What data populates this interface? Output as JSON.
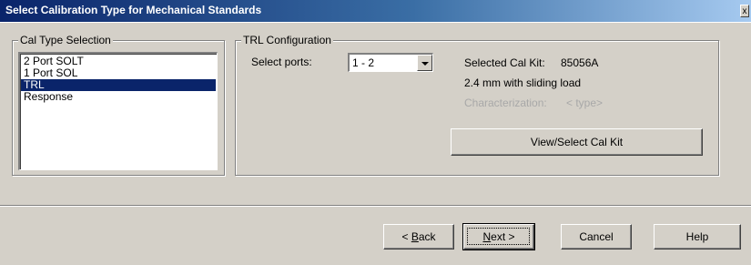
{
  "window": {
    "title": "Select Calibration Type for Mechanical Standards",
    "close_glyph": "x"
  },
  "cal_type": {
    "legend": "Cal Type Selection",
    "items": [
      "2 Port SOLT",
      "1 Port SOL",
      "TRL",
      "Response"
    ],
    "selected": "TRL"
  },
  "trl": {
    "legend": "TRL Configuration",
    "select_ports_label": "Select ports:",
    "ports_value": "1 - 2",
    "selected_cal_kit_label": "Selected Cal Kit:",
    "selected_cal_kit_value": "85056A",
    "kit_description": "2.4 mm with sliding load",
    "characterization_label": "Characterization:",
    "characterization_value": "< type>",
    "view_select_button": "View/Select Cal Kit"
  },
  "footer": {
    "back": {
      "pre": "< ",
      "accel": "B",
      "post": "ack"
    },
    "next": {
      "accel": "N",
      "post": "ext >"
    },
    "cancel": "Cancel",
    "help": "Help"
  }
}
